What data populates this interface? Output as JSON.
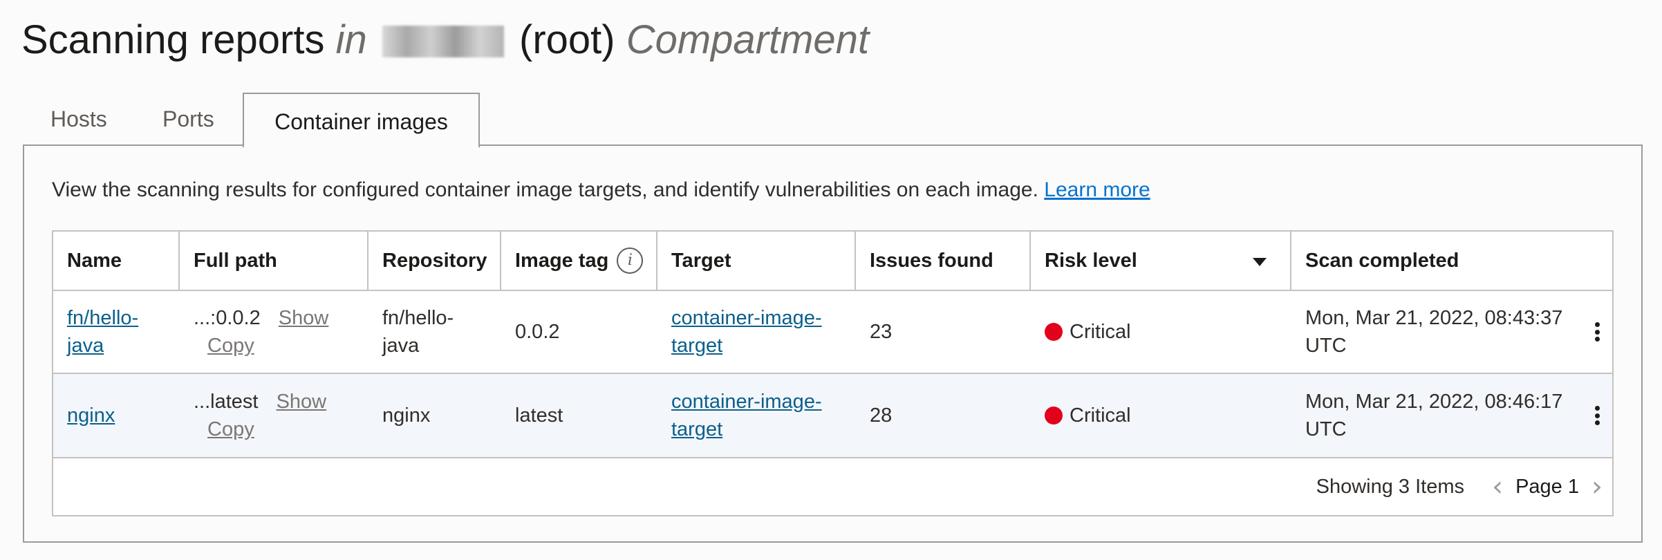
{
  "header": {
    "title": "Scanning reports",
    "in_word": "in",
    "root_label": "(root)",
    "scope_word": "Compartment"
  },
  "tabs": [
    {
      "label": "Hosts"
    },
    {
      "label": "Ports"
    },
    {
      "label": "Container images"
    }
  ],
  "description": {
    "text": "View the scanning results for configured container image targets, and identify vulnerabilities on each image.",
    "link": "Learn more"
  },
  "table": {
    "columns": [
      "Name",
      "Full path",
      "Repository",
      "Image tag",
      "Target",
      "Issues found",
      "Risk level",
      "Scan completed"
    ],
    "rows": [
      {
        "name_l1": "fn/hello-",
        "name_l2": "java",
        "path_short": "...:0.0.2",
        "show": "Show",
        "copy": "Copy",
        "repo_l1": "fn/hello-",
        "repo_l2": "java",
        "tag": "0.0.2",
        "target_l1": "container-image-",
        "target_l2": "target",
        "issues": "23",
        "risk": "Critical",
        "scan_l1": "Mon, Mar 21, 2022, 08:43:37",
        "scan_l2": "UTC"
      },
      {
        "name_l1": "nginx",
        "path_short": "...latest",
        "show": "Show",
        "copy": "Copy",
        "repo_l1": "nginx",
        "tag": "latest",
        "target_l1": "container-image-",
        "target_l2": "target",
        "issues": "28",
        "risk": "Critical",
        "scan_l1": "Mon, Mar 21, 2022, 08:46:17",
        "scan_l2": "UTC"
      }
    ]
  },
  "footer": {
    "showing": "Showing 3 Items",
    "page": "Page 1"
  },
  "colors": {
    "critical": "#e3001b",
    "link": "#0c5f8c",
    "learn_more": "#0572ce"
  }
}
